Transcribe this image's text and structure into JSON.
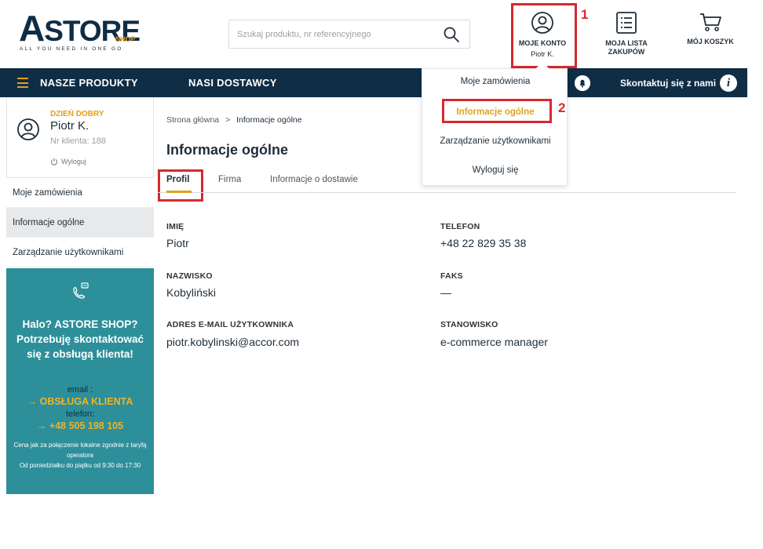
{
  "logo": {
    "letter": "A",
    "rest": "STORE",
    "shop": "SHOP",
    "tagline": "ALL YOU NEED IN ONE GO"
  },
  "search": {
    "placeholder": "Szukaj produktu, nr referencyjnego"
  },
  "header": {
    "account_label": "MOJE KONTO",
    "account_user": "Piotr K.",
    "shoplist_label_1": "MOJA LISTA",
    "shoplist_label_2": "ZAKUPÓW",
    "cart_label": "MÓJ KOSZYK"
  },
  "annotations": {
    "step1": "1",
    "step2": "2",
    "color": "#d42a2f"
  },
  "nav": {
    "products": "NASZE PRODUKTY",
    "suppliers": "NASI DOSTAWCY",
    "contact": "Skontaktuj się z nami",
    "info_glyph": "i"
  },
  "dropdown": {
    "items": [
      "Moje zamówienia",
      "Informacje ogólne",
      "Zarządzanie użytkownikami",
      "Wyloguj się"
    ],
    "active_index": 1
  },
  "sidebar": {
    "greeting": "DZIEŃ DOBRY",
    "name": "Piotr K.",
    "client_no": "Nr klienta: 188",
    "logout": "Wyloguj",
    "items": [
      "Moje zamówienia",
      "Informacje ogólne",
      "Zarządzanie użytkownikami"
    ],
    "active_index": 1
  },
  "support": {
    "title": "Halo? ASTORE SHOP? Potrzebuję skontaktować się z obsługą klienta!",
    "email_label": "email :",
    "email_value": "OBSŁUGA KLIENTA",
    "phone_label": "telefon:",
    "phone_value": "+48 505 198 105",
    "note_1": "Cena jak za połączenie lokalne zgodnie z taryfą operatora",
    "note_2": "Od poniedziałku do piątku od 9:30 do 17:30"
  },
  "breadcrumb": {
    "home": "Strona główna",
    "separator": ">",
    "current": "Informacje ogólne"
  },
  "page_title": "Informacje ogólne",
  "tabs": [
    "Profil",
    "Firma",
    "Informacje o dostawie"
  ],
  "profile": {
    "first_name_label": "IMIĘ",
    "first_name": "Piotr",
    "last_name_label": "NAZWISKO",
    "last_name": "Kobyliński",
    "email_label": "ADRES E-MAIL UŻYTKOWNIKA",
    "email": "piotr.kobylinski@accor.com",
    "phone_label": "TELEFON",
    "phone": "+48 22 829 35 38",
    "fax_label": "FAKS",
    "fax": "—",
    "position_label": "STANOWISKO",
    "position": "e-commerce manager"
  },
  "colors": {
    "navy": "#0f2d45",
    "gold": "#e0a11c",
    "teal": "#2d8f9a"
  }
}
